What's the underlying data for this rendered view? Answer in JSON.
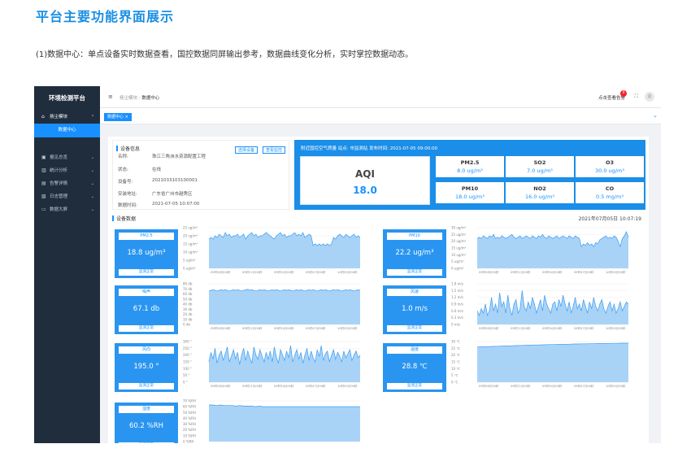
{
  "heading": "平台主要功能界面展示",
  "intro": "(1)数据中心：单点设备实时数据查看，国控数据同屏输出参考，数据曲线变化分析，实时掌控数据动态。",
  "app": {
    "title": "环境检测平台",
    "sidebar": [
      {
        "label": "扬尘模块",
        "icon": "home-icon",
        "expanded": true
      },
      {
        "label": "数据中心",
        "sub": true,
        "active": true
      },
      {
        "label": "报见总览",
        "icon": "monitor-icon"
      },
      {
        "label": "统计分析",
        "icon": "bar-chart-icon"
      },
      {
        "label": "告警详情",
        "icon": "document-icon"
      },
      {
        "label": "日志管理",
        "icon": "log-icon"
      },
      {
        "label": "数据大屏",
        "icon": "screen-icon"
      }
    ],
    "breadcrumb": [
      "扬尘模块",
      "数据中心"
    ],
    "top_right": {
      "alert": "0",
      "alert_label": "点击查看告警",
      "logout": "退"
    },
    "tab": "数据中心 ×"
  },
  "device": {
    "title": "设备信息",
    "buttons": [
      "选择设备",
      "查看监控"
    ],
    "rows": [
      {
        "label": "名称:",
        "value": "珠江三角洲水资源配置工程"
      },
      {
        "label": "状态:",
        "value": "在线"
      },
      {
        "label": "设备号:",
        "value": "2021033103100001"
      },
      {
        "label": "安装地址:",
        "value": "广东省广州市越秀区"
      },
      {
        "label": "数据时间:",
        "value": "2021-07-05 10:07:00"
      }
    ]
  },
  "air": {
    "header": "附近国控空气质量    站点: 市监测站    发布时间: 2021-07-05 09:00:00",
    "aqi_label": "AQI",
    "aqi_value": "18.0",
    "pollutants": [
      {
        "name": "PM2.5",
        "value": "8.0 ug/m³"
      },
      {
        "name": "SO2",
        "value": "7.0 ug/m³"
      },
      {
        "name": "O3",
        "value": "30.0 ug/m³"
      },
      {
        "name": "PM10",
        "value": "18.0 ug/m³"
      },
      {
        "name": "NO2",
        "value": "16.0 ug/m³"
      },
      {
        "name": "CO",
        "value": "0.5 mg/m³"
      }
    ]
  },
  "data_section": {
    "title": "设备数据",
    "date": "2021年07月05日 10:07:19"
  },
  "cards": [
    {
      "title": "PM2.5",
      "value": "18.8 ug/m³",
      "status": "监测正常"
    },
    {
      "title": "PM10",
      "value": "22.2 ug/m³",
      "status": "监测正常"
    },
    {
      "title": "噪声",
      "value": "67.1 db",
      "status": "监测正常"
    },
    {
      "title": "风速",
      "value": "1.0 m/s",
      "status": "监测正常"
    },
    {
      "title": "风向",
      "value": "195.0 °",
      "status": "监测正常"
    },
    {
      "title": "温度",
      "value": "28.8 ℃",
      "status": "监测正常"
    },
    {
      "title": "湿度",
      "value": "60.2 %RH",
      "status": "监测正常"
    }
  ],
  "colors": {
    "accent": "#1890ff",
    "sidebar": "#1f2d3d",
    "card": "#2a95f0",
    "area_fill": "#a8d3f7",
    "area_line": "#3c9cf0"
  },
  "chart_data": [
    {
      "type": "area",
      "name": "PM2.5",
      "yticks": [
        "0 ug/m³",
        "5 ug/m³",
        "10 ug/m³",
        "15 ug/m³",
        "20 ug/m³",
        "25 ug/m³"
      ],
      "ylim": [
        0,
        25
      ],
      "xticks": [
        "09时08分00秒",
        "09时21分00秒",
        "09时34分00秒",
        "09时47分00秒",
        "10时00分00秒"
      ],
      "values": [
        18,
        19,
        18,
        20,
        19,
        21,
        20,
        19,
        22,
        20,
        21,
        19,
        20,
        20,
        21,
        19,
        20,
        21,
        18,
        20,
        21,
        22,
        20,
        21,
        19,
        20,
        20,
        21,
        22,
        21,
        20,
        19,
        18,
        20,
        21,
        22,
        20,
        21,
        19,
        20,
        20,
        21,
        22,
        20,
        21,
        20,
        22,
        19,
        20,
        21,
        20,
        14,
        15,
        14,
        15,
        14,
        15,
        14,
        15,
        14,
        15,
        19,
        18,
        20,
        21,
        20,
        19,
        21,
        20,
        19,
        20,
        21,
        19,
        20,
        19
      ]
    },
    {
      "type": "area",
      "name": "PM10",
      "yticks": [
        "0 ug/m³",
        "5 ug/m³",
        "10 ug/m³",
        "15 ug/m³",
        "20 ug/m³",
        "25 ug/m³",
        "30 ug/m³"
      ],
      "ylim": [
        0,
        30
      ],
      "xticks": [
        "09时08分00秒",
        "09时21分00秒",
        "09时34分00秒",
        "09时47分00秒",
        "10时00分00秒"
      ],
      "values": [
        22,
        23,
        22,
        24,
        23,
        22,
        24,
        23,
        25,
        22,
        23,
        22,
        24,
        23,
        22,
        23,
        24,
        25,
        23,
        22,
        23,
        24,
        22,
        23,
        24,
        23,
        22,
        24,
        23,
        22,
        24,
        23,
        25,
        23,
        22,
        24,
        23,
        22,
        23,
        24,
        22,
        23,
        24,
        23,
        22,
        24,
        23,
        22,
        24,
        23,
        22,
        16,
        18,
        17,
        19,
        17,
        18,
        16,
        19,
        18,
        21,
        22,
        23,
        24,
        22,
        23,
        22,
        24,
        23,
        20,
        16,
        22,
        24,
        27,
        23
      ]
    },
    {
      "type": "area",
      "name": "噪声",
      "yticks": [
        "0 db",
        "10 db",
        "20 db",
        "30 db",
        "40 db",
        "50 db",
        "60 db",
        "70 db",
        "80 db"
      ],
      "ylim": [
        0,
        80
      ],
      "xticks": [
        "09时08分00秒",
        "09时21分00秒",
        "09时34分00秒",
        "09时47分00秒",
        "10时00分00秒"
      ],
      "values": [
        66,
        67,
        68,
        67,
        66,
        67,
        68,
        67,
        68,
        67,
        66,
        67,
        68,
        67,
        68,
        67,
        66,
        67,
        68,
        69,
        67,
        68,
        67,
        66,
        67,
        68,
        67,
        68,
        67,
        66,
        67,
        68,
        67,
        68,
        67,
        66,
        67,
        68,
        67,
        68,
        67,
        66,
        67,
        68,
        67,
        68,
        67,
        66,
        67,
        68,
        67,
        68,
        67,
        66,
        67,
        68,
        67,
        68,
        67,
        66,
        67,
        68,
        67,
        68,
        67,
        66,
        67,
        68,
        67,
        68,
        67,
        66,
        67,
        68,
        67
      ]
    },
    {
      "type": "area",
      "name": "风速",
      "yticks": [
        "0 m/s",
        "0.3 m/s",
        "0.6 m/s",
        "0.9 m/s",
        "1.2 m/s",
        "1.5 m/s",
        "1.8 m/s"
      ],
      "ylim": [
        0,
        1.8
      ],
      "xticks": [
        "09时08分00秒",
        "09时21分00秒",
        "09时34分00秒",
        "09时47分00秒",
        "10时00分00秒"
      ],
      "values": [
        0.6,
        0.4,
        0.7,
        0.5,
        0.9,
        0.4,
        0.6,
        1.2,
        0.6,
        0.9,
        0.5,
        1.4,
        0.8,
        1.0,
        0.5,
        1.3,
        0.7,
        0.4,
        0.9,
        1.1,
        0.5,
        0.7,
        1.5,
        0.8,
        0.6,
        1.0,
        0.7,
        1.2,
        0.9,
        0.5,
        0.8,
        1.1,
        0.6,
        1.3,
        0.9,
        0.7,
        0.5,
        0.9,
        1.0,
        0.6,
        1.1,
        0.8,
        1.3,
        0.9,
        0.6,
        1.0,
        0.5,
        0.8,
        1.2,
        0.7,
        0.9,
        0.6,
        1.1,
        0.8,
        0.5,
        1.0,
        0.7,
        1.2,
        0.8,
        0.6,
        0.9,
        1.1,
        0.7,
        0.5,
        0.8,
        1.0,
        0.6,
        0.9,
        0.5,
        0.7,
        1.0,
        0.6,
        0.8,
        1.0,
        0.9
      ]
    },
    {
      "type": "area",
      "name": "风向",
      "yticks": [
        "0 °",
        "50 °",
        "100 °",
        "150 °",
        "200 °",
        "250 °",
        "300 °"
      ],
      "ylim": [
        0,
        300
      ],
      "xticks": [
        "09时08分00秒",
        "09时21分00秒",
        "09时34分00秒",
        "09时47分00秒",
        "10时00分00秒"
      ],
      "values": [
        150,
        220,
        170,
        250,
        140,
        200,
        230,
        160,
        210,
        260,
        150,
        190,
        240,
        170,
        220,
        130,
        200,
        250,
        160,
        230,
        180,
        140,
        260,
        200,
        170,
        240,
        190,
        150,
        220,
        170,
        230,
        150,
        260,
        190,
        140,
        240,
        200,
        160,
        230,
        180,
        270,
        150,
        200,
        240,
        170,
        220,
        140,
        200,
        250,
        160,
        230,
        180,
        150,
        240,
        190,
        270,
        160,
        210,
        230,
        150,
        200,
        240,
        170,
        220,
        190,
        150,
        230,
        180,
        210,
        240,
        160,
        200,
        230,
        180,
        200
      ]
    },
    {
      "type": "area",
      "name": "温度",
      "yticks": [
        "0 ℃",
        "5 ℃",
        "10 ℃",
        "15 ℃",
        "20 ℃",
        "25 ℃",
        "30 ℃"
      ],
      "ylim": [
        0,
        30
      ],
      "xticks": [
        "09时08分00秒",
        "09时21分00秒",
        "09时34分00秒",
        "09时47分00秒",
        "10时00分00秒"
      ],
      "values": [
        26.0,
        26.1,
        26.2,
        26.3,
        26.4,
        26.5,
        26.6,
        26.7,
        26.8,
        26.9,
        27.0,
        27.1,
        27.2,
        27.3,
        27.4,
        27.5,
        27.5,
        27.6,
        27.7,
        27.8,
        27.8,
        27.9,
        28.0,
        28.0,
        28.1,
        28.2,
        28.2,
        28.3,
        28.3,
        28.4,
        28.4,
        28.5,
        28.5,
        28.6,
        28.6,
        28.7,
        28.7,
        28.8,
        28.8,
        28.8
      ]
    },
    {
      "type": "area",
      "name": "湿度",
      "yticks": [
        "0 %RH",
        "10 %RH",
        "20 %RH",
        "30 %RH",
        "40 %RH",
        "50 %RH",
        "60 %RH",
        "70 %RH"
      ],
      "ylim": [
        0,
        70
      ],
      "xticks": [
        "09时08分00秒",
        "09时21分00秒",
        "09时34分00秒",
        "09时47分00秒",
        "10时00分00秒"
      ],
      "values": [
        63,
        63,
        62,
        63,
        62,
        62,
        62,
        61,
        62,
        61,
        61,
        61,
        60,
        61,
        60,
        60,
        60,
        60,
        60,
        60,
        60,
        60,
        60,
        60,
        60,
        60,
        60,
        60,
        60,
        60,
        60,
        60,
        60,
        60,
        60,
        60,
        60,
        60,
        60,
        60
      ]
    }
  ]
}
